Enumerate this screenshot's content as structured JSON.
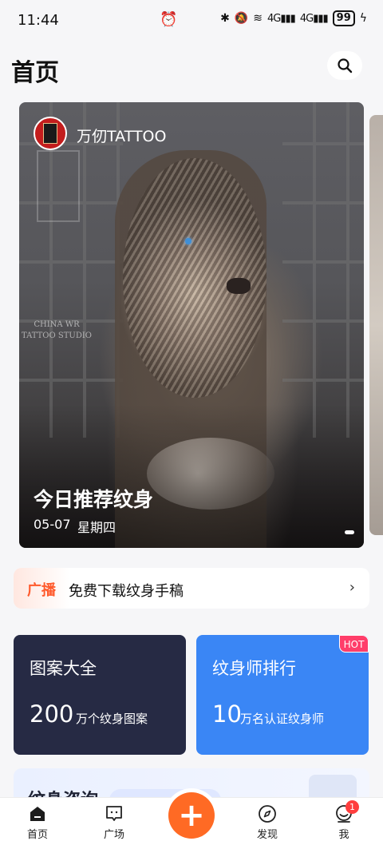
{
  "status_bar": {
    "time": "11:44",
    "network_label": "4G",
    "battery": "99"
  },
  "header": {
    "title": "首页"
  },
  "banner": {
    "studio_name": "万仞TATTOO",
    "watermark_line1": "CHINA WR",
    "watermark_line2": "TATTOO STUDIO",
    "title": "今日推荐纹身",
    "date": "05-07",
    "weekday": "星期四"
  },
  "broadcast": {
    "tag": "广播",
    "text": "免费下载纹身手稿",
    "arrow": "›"
  },
  "cards": {
    "patterns": {
      "title": "图案大全",
      "number": "200",
      "unit": "万个纹身图案"
    },
    "artists": {
      "title": "纹身师排行",
      "number": "10",
      "unit": "万名认证纹身师",
      "badge": "HOT"
    }
  },
  "consult": {
    "title": "纹身咨询"
  },
  "tab_bar": {
    "tabs": [
      {
        "label": "首页",
        "icon": "home-icon",
        "active": true
      },
      {
        "label": "广场",
        "icon": "square-icon",
        "active": false
      },
      {
        "label": "",
        "icon": "plus-icon",
        "active": false
      },
      {
        "label": "发现",
        "icon": "compass-icon",
        "active": false
      },
      {
        "label": "我",
        "icon": "profile-icon",
        "active": false
      }
    ],
    "add_symbol": "+",
    "badge_count": "1"
  },
  "colors": {
    "accent": "#ff6a24",
    "broadcast_tag": "#ff5a2c",
    "patterns_card": "#262a44",
    "artists_card": "#3a86f5",
    "hot_badge": "#ff3e6a"
  }
}
